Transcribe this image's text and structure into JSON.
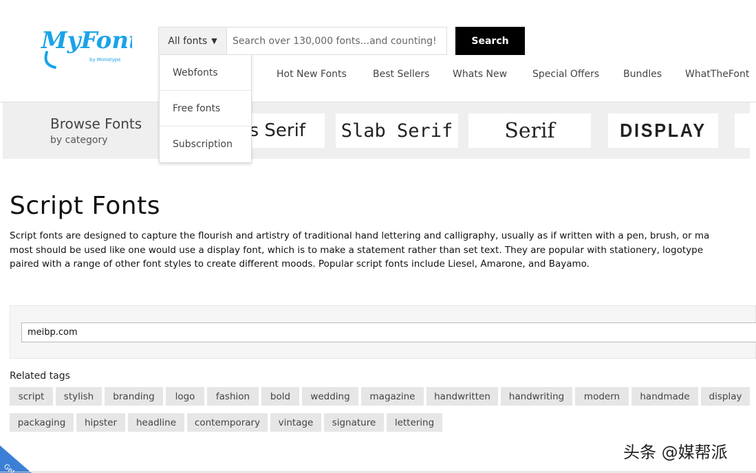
{
  "logo": {
    "text": "MyFonts",
    "byline": "by Monotype",
    "color": "#1aa3e8"
  },
  "search": {
    "scope_label": "All fonts",
    "caret": "▼",
    "placeholder": "Search over 130,000 fonts...and counting!",
    "button_label": "Search"
  },
  "scope_menu": {
    "items": [
      {
        "label": "Webfonts"
      },
      {
        "label": "Free fonts"
      },
      {
        "label": "Subscription"
      }
    ]
  },
  "nav": {
    "items": [
      {
        "label": "Hot New Fonts"
      },
      {
        "label": "Best Sellers"
      },
      {
        "label": "Whats New"
      },
      {
        "label": "Special Offers"
      },
      {
        "label": "Bundles"
      },
      {
        "label": "WhatTheFont"
      }
    ]
  },
  "browse": {
    "title": "Browse Fonts",
    "subtitle": "by category",
    "categories": [
      {
        "label": "s Serif"
      },
      {
        "label": "Slab Serif"
      },
      {
        "label": "Serif"
      },
      {
        "label": "DISPLAY"
      }
    ]
  },
  "main": {
    "title": "Script Fonts",
    "intro": [
      "Script fonts are designed to capture the flourish and artistry of traditional hand lettering and calligraphy, usually as if written with a pen, brush, or ma",
      "most should be used like one would use a display font, which is to make a statement rather than set text. They are popular with stationery, logotype",
      "paired with a range of other font styles to create different moods. Popular script fonts include Liesel, Amarone, and Bayamo."
    ]
  },
  "filter": {
    "value": "meibp.com"
  },
  "related": {
    "label": "Related tags",
    "row1": [
      "script",
      "stylish",
      "branding",
      "logo",
      "fashion",
      "bold",
      "wedding",
      "magazine",
      "handwritten",
      "handwriting",
      "modern",
      "handmade",
      "display"
    ],
    "row2": [
      "packaging",
      "hipster",
      "headline",
      "contemporary",
      "vintage",
      "signature",
      "lettering"
    ]
  },
  "corner_tab": {
    "text": "Get",
    "color": "#3b7fd6"
  },
  "watermark": {
    "text": "头条 @媒帮派"
  }
}
